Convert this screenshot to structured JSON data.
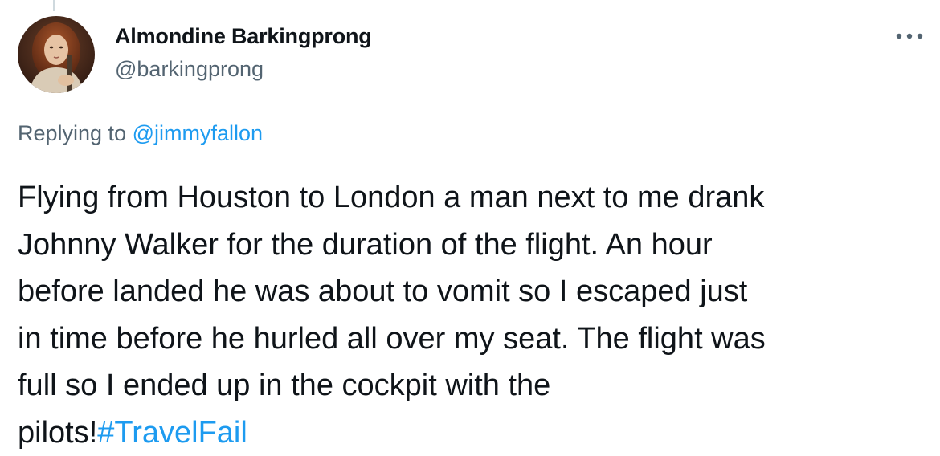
{
  "tweet": {
    "author": {
      "display_name": "Almondine Barkingprong",
      "handle": "@barkingprong"
    },
    "reply_context": {
      "prefix": "Replying to ",
      "mention": "@jimmyfallon"
    },
    "text_lines": [
      "Flying from Houston to London a man next to me drank",
      "Johnny Walker for the duration of the flight. An hour",
      "before landed he was about to vomit so I escaped just",
      "in time before he hurled all over my seat. The flight was",
      "full so I ended up in the cockpit with the",
      "pilots!"
    ],
    "hashtag": "#TravelFail"
  },
  "icons": {
    "more": "more-horizontal-icon"
  },
  "colors": {
    "link": "#1d9bf0",
    "secondary_text": "#536471",
    "primary_text": "#0f1419"
  }
}
